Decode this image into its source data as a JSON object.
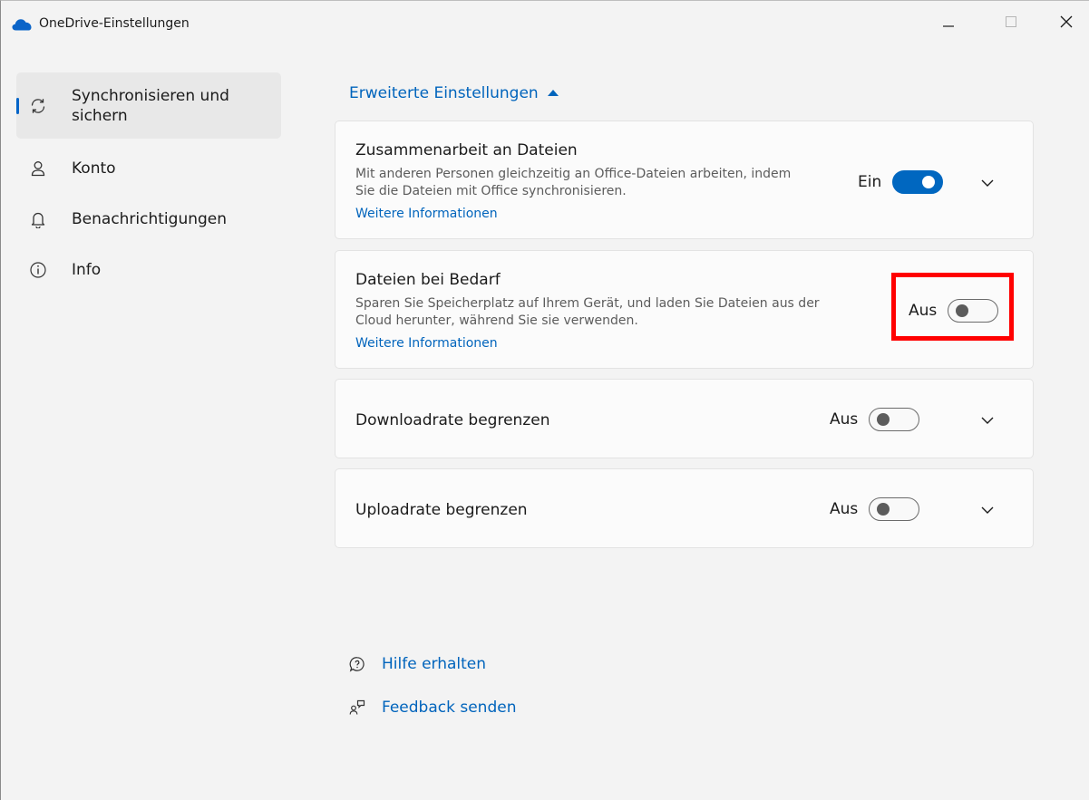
{
  "window": {
    "title": "OneDrive-Einstellungen",
    "minimize_icon": "minimize-icon",
    "maximize_icon": "maximize-icon",
    "close_icon": "close-icon"
  },
  "sidebar": {
    "items": [
      {
        "label_line1": "Synchronisieren und",
        "label_line2": "sichern",
        "icon": "sync-icon",
        "active": true
      },
      {
        "label": "Konto",
        "icon": "person-icon",
        "active": false
      },
      {
        "label": "Benachrichtigungen",
        "icon": "bell-icon",
        "active": false
      },
      {
        "label": "Info",
        "icon": "info-icon",
        "active": false
      }
    ]
  },
  "main": {
    "advanced_link": "Erweiterte Einstellungen",
    "cards": [
      {
        "title": "Zusammenarbeit an Dateien",
        "desc_line1": "Mit anderen Personen gleichzeitig an Office-Dateien arbeiten, indem",
        "desc_line2": "Sie die Dateien mit Office synchronisieren.",
        "link": "Weitere Informationen",
        "toggle_label": "Ein",
        "toggle_on": true
      },
      {
        "title": "Dateien bei Bedarf",
        "desc_line1": "Sparen Sie Speicherplatz auf Ihrem Gerät, und laden Sie Dateien aus der",
        "desc_line2": "Cloud herunter, während Sie sie verwenden.",
        "link": "Weitere Informationen",
        "toggle_label": "Aus",
        "toggle_on": false
      },
      {
        "title": "Downloadrate begrenzen",
        "toggle_label": "Aus",
        "toggle_on": false
      },
      {
        "title": "Uploadrate begrenzen",
        "toggle_label": "Aus",
        "toggle_on": false
      }
    ],
    "help_link": "Hilfe erhalten",
    "feedback_link": "Feedback senden"
  },
  "colors": {
    "accent": "#0067c0",
    "link": "#0064bc",
    "highlight": "#ff0000"
  }
}
